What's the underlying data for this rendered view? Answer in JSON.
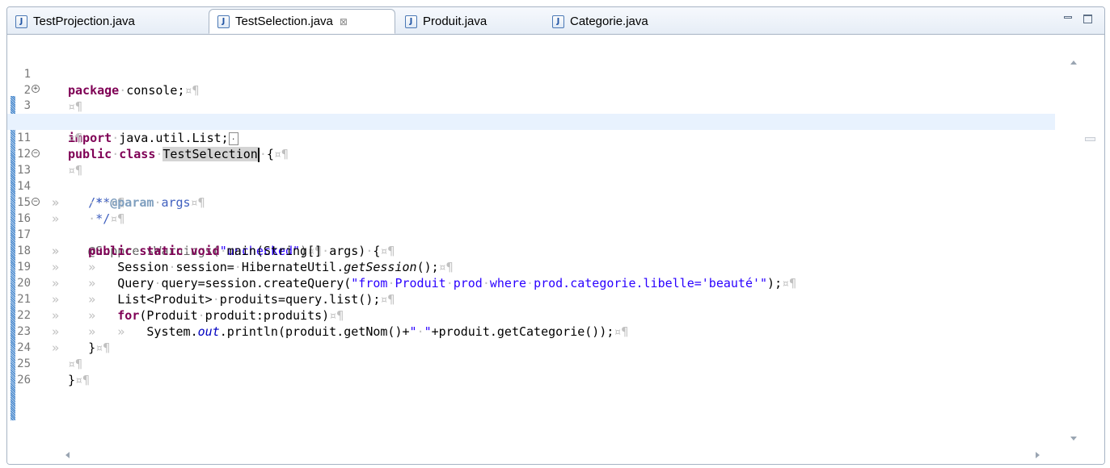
{
  "tabs": [
    {
      "label": "TestProjection.java",
      "active": false,
      "icon": "java-file-icon"
    },
    {
      "label": "TestSelection.java",
      "active": true,
      "icon": "java-file-icon",
      "close": "⊠"
    },
    {
      "label": "Produit.java",
      "active": false,
      "icon": "java-file-icon"
    },
    {
      "label": "Categorie.java",
      "active": false,
      "icon": "java-file-icon"
    }
  ],
  "editor": {
    "line_numbers": [
      "1",
      "2",
      "3",
      "10",
      "11",
      "12",
      "13",
      "14",
      "15",
      "16",
      "17",
      "18",
      "19",
      "20",
      "21",
      "22",
      "23",
      "24",
      "25",
      "26"
    ],
    "ws": {
      "pilcrow": "¤¶",
      "tab": "»",
      "dot": "·"
    },
    "code": {
      "l1_kw": "package",
      "l1_rest": "console;",
      "l3_kw": "import",
      "l3_rest": "java.util.List;",
      "l11_kw1": "public",
      "l11_kw2": "class",
      "l11_name": "TestSelection",
      "l11_brace": "{",
      "l13": "/**",
      "l14_star": "*",
      "l14_tag": "@param",
      "l14_arg": "args",
      "l15": "*/",
      "l16_ann": "@SuppressWarnings(",
      "l16_str": "\"unchecked\"",
      "l16_end": ")",
      "l17_kw1": "public",
      "l17_kw2": "static",
      "l17_kw3": "void",
      "l17_rest1": "main(String[]",
      "l17_rest2": "args)",
      "l17_rest3": "{",
      "l18_a": "Session",
      "l18_b": "session=",
      "l18_c": "HibernateUtil.",
      "l18_method": "getSession",
      "l18_d": "();",
      "l19_a": "Query",
      "l19_b": "query=session.createQuery(",
      "l19_s1": "\"from",
      "l19_s2": "Produit",
      "l19_s3": "prod",
      "l19_s4": "where",
      "l19_s5": "prod.categorie.libelle='beauté'\"",
      "l19_end": ");",
      "l20_a": "List<Produit>",
      "l20_b": "produits=query.list();",
      "l21_kw": "for",
      "l21_a": "(Produit",
      "l21_b": "produit:produits)",
      "l22_a": "System.",
      "l22_field": "out",
      "l22_b": ".println(produit.getNom()+",
      "l22_s1": "\"",
      "l22_s2": "\"",
      "l22_c": "+produit.getCategorie());",
      "l23": "}",
      "l25": "}"
    }
  }
}
